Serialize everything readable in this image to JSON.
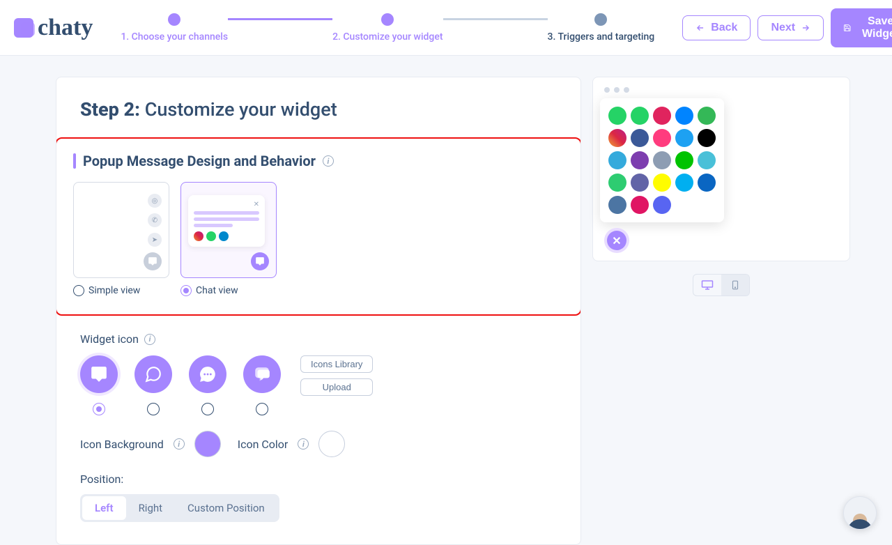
{
  "logo": {
    "text": "chaty"
  },
  "stepper": {
    "steps": [
      {
        "label": "1. Choose your channels",
        "active": true
      },
      {
        "label": "2. Customize your widget",
        "active": true
      },
      {
        "label": "3. Triggers and targeting",
        "active": false
      }
    ]
  },
  "header": {
    "back": "Back",
    "next": "Next",
    "save": "Save Widget"
  },
  "panel": {
    "title_strong": "Step 2:",
    "title_rest": " Customize your widget"
  },
  "popup_section": {
    "title": "Popup Message Design and Behavior",
    "options": {
      "simple": "Simple view",
      "chat": "Chat view"
    },
    "selected": "chat"
  },
  "widget_icon": {
    "label": "Widget icon",
    "selected_index": 0,
    "icons_library": "Icons Library",
    "upload": "Upload"
  },
  "colors": {
    "icon_background_label": "Icon Background",
    "icon_background": "#a586ff",
    "icon_color_label": "Icon Color",
    "icon_color": "#ffffff"
  },
  "position": {
    "label": "Position:",
    "options": [
      "Left",
      "Right",
      "Custom Position"
    ],
    "selected": "Left"
  },
  "preview": {
    "icons": [
      {
        "bg": "#25D366"
      },
      {
        "bg": "#25D366"
      },
      {
        "bg": "#E0245E"
      },
      {
        "bg": "#0084FF"
      },
      {
        "bg": "#34b857"
      },
      {
        "bg": "linear-gradient(45deg,#f09433,#e6683c,#dc2743,#cc2366,#bc1888)"
      },
      {
        "bg": "#3b5998"
      },
      {
        "bg": "#ff3c7e"
      },
      {
        "bg": "#1DA1F2"
      },
      {
        "bg": "#000000"
      },
      {
        "bg": "#34aadc"
      },
      {
        "bg": "#7d3daf"
      },
      {
        "bg": "#8d9db3"
      },
      {
        "bg": "#00c300"
      },
      {
        "bg": "#49c0d8"
      },
      {
        "bg": "#2ecc71"
      },
      {
        "bg": "#6264a7"
      },
      {
        "bg": "#FFFC00"
      },
      {
        "bg": "#00aff0"
      },
      {
        "bg": "#0a66c2"
      },
      {
        "bg": "#4c75a3"
      },
      {
        "bg": "#e01563"
      },
      {
        "bg": "#5865F2"
      }
    ],
    "device_selected": "desktop"
  }
}
